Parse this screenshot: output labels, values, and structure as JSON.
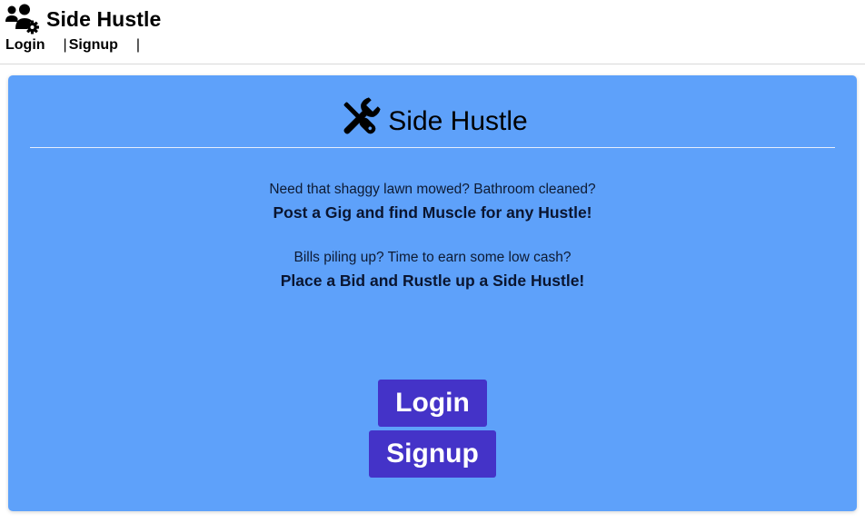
{
  "header": {
    "brand_title": "Side Hustle",
    "brand_icon": "users-gear-icon",
    "nav": {
      "login_label": "Login",
      "signup_label": "Signup",
      "separator": "|"
    }
  },
  "hero": {
    "title": "Side Hustle",
    "title_icon": "tools-icon",
    "question_1": "Need that shaggy lawn mowed? Bathroom cleaned?",
    "cta_1": "Post a Gig and find Muscle for any Hustle!",
    "question_2": "Bills piling up? Time to earn some low cash?",
    "cta_2": "Place a Bid and Rustle up a Side Hustle!",
    "login_button": "Login",
    "signup_button": "Signup"
  },
  "colors": {
    "hero_background": "#5ea1fa",
    "button_background": "#4433c8",
    "button_text": "#ffffff"
  }
}
